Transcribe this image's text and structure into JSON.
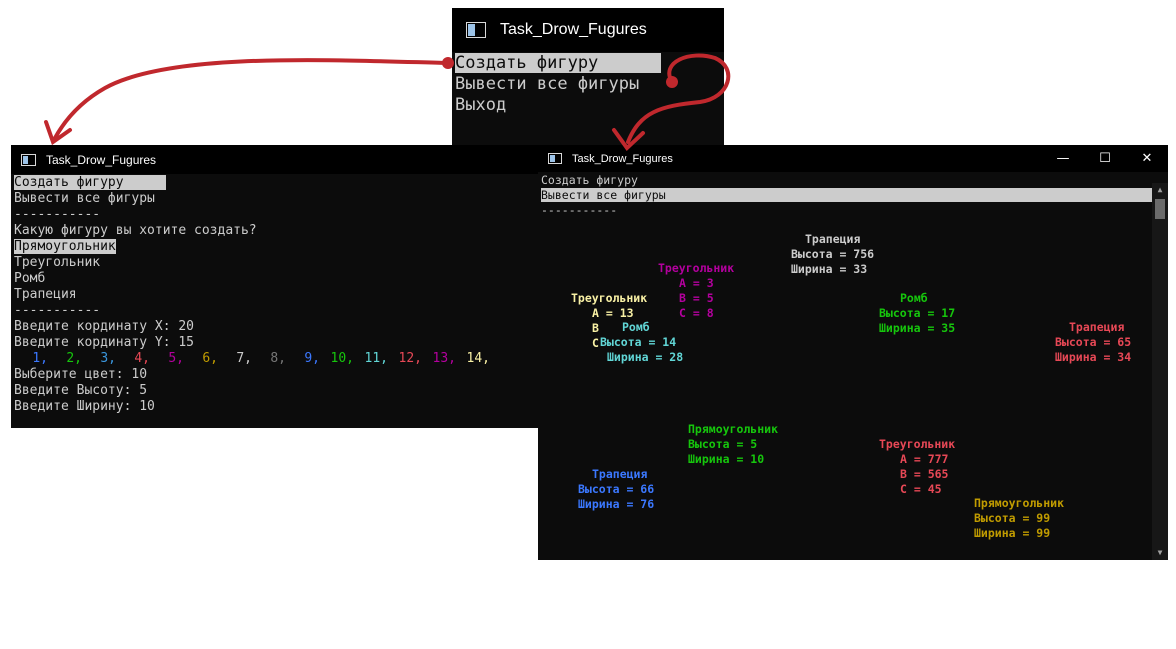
{
  "window_top": {
    "title": "Task_Drow_Fugures",
    "menu": [
      "Создать фигуру",
      "Вывести все фигуры",
      "Выход"
    ],
    "selected_index": 0
  },
  "window_left": {
    "title": "Task_Drow_Fugures",
    "menu": [
      "Создать фигуру",
      "Вывести все фигуры"
    ],
    "separator": "-----------",
    "question": "Какую фигуру вы хотите создать?",
    "figure_options": [
      "Прямоугольник",
      "Треугольник",
      "Ромб",
      "Трапеция"
    ],
    "separator2": "-----------",
    "input_x": "Введите кординату X: 20",
    "input_y": "Введите кординату Y: 15",
    "color_options": [
      {
        "label": "1,",
        "color": "#3b78ff"
      },
      {
        "label": "2,",
        "color": "#16c60c"
      },
      {
        "label": "3,",
        "color": "#3a96dd"
      },
      {
        "label": "4,",
        "color": "#e74856"
      },
      {
        "label": "5,",
        "color": "#b4009e"
      },
      {
        "label": "6,",
        "color": "#c19c00"
      },
      {
        "label": "7,",
        "color": "#cccccc"
      },
      {
        "label": "8,",
        "color": "#767676"
      },
      {
        "label": "9,",
        "color": "#3b78ff"
      },
      {
        "label": "10,",
        "color": "#16c60c"
      },
      {
        "label": "11,",
        "color": "#61d6d6"
      },
      {
        "label": "12,",
        "color": "#e74856"
      },
      {
        "label": "13,",
        "color": "#b4009e"
      },
      {
        "label": "14,",
        "color": "#f9f1a5"
      }
    ],
    "choose_color": "Выберите цвет: 10",
    "input_height": "Введите Высоту: 5",
    "input_width": "Введите Ширину: 10"
  },
  "window_right": {
    "title": "Task_Drow_Fugures",
    "menu": [
      "Создать фигуру",
      "Вывести все фигуры"
    ],
    "selected_index": 1,
    "separator": "-----------",
    "controls": {
      "minimize": "—",
      "maximize": "☐",
      "close": "✕"
    },
    "scroll": {
      "up": "▲",
      "down": "▼"
    },
    "figures": [
      {
        "color": "#cccccc",
        "lines": [
          "Трапеция",
          "Высота = 756",
          "Ширина = 33"
        ]
      },
      {
        "color": "#b4009e",
        "lines": [
          "Треугольник",
          "A = 3",
          "B = 5",
          "C = 8"
        ]
      },
      {
        "color": "#f9f1a5",
        "lines": [
          "Треугольник",
          "A = 13",
          "B",
          "C"
        ]
      },
      {
        "color": "#61d6d6",
        "lines": [
          "Ромб",
          "Высота = 14",
          "Ширина = 28"
        ]
      },
      {
        "color": "#16c60c",
        "lines": [
          "Ромб",
          "Высота = 17",
          "Ширина = 35"
        ]
      },
      {
        "color": "#e74856",
        "lines": [
          "Трапеция",
          "Высота = 65",
          "Ширина = 34"
        ]
      },
      {
        "color": "#16c60c",
        "lines": [
          "Прямоугольник",
          "Высота = 5",
          "Ширина = 10"
        ]
      },
      {
        "color": "#e74856",
        "lines": [
          "Треугольник",
          "A = 777",
          "B = 565",
          "C = 45"
        ]
      },
      {
        "color": "#3b78ff",
        "lines": [
          "Трапеция",
          "Высота = 66",
          "Ширина = 76"
        ]
      },
      {
        "color": "#c19c00",
        "lines": [
          "Прямоугольник",
          "Высота = 99",
          "Ширина = 99"
        ]
      }
    ]
  },
  "arrow_color": "#c0282d"
}
